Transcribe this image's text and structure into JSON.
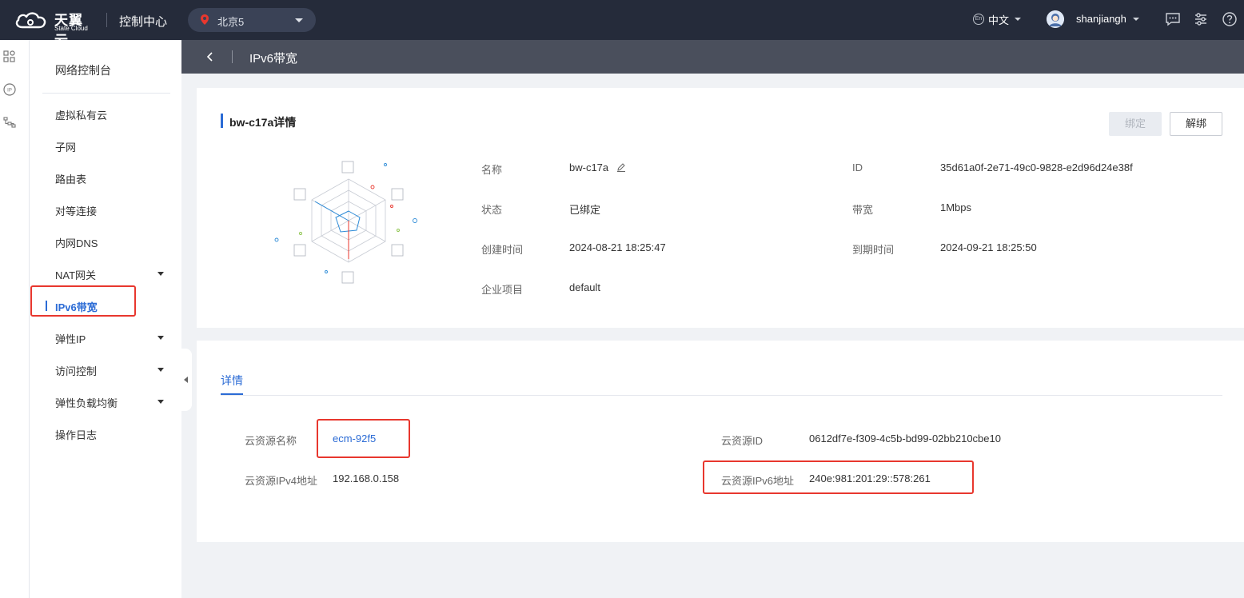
{
  "topbar": {
    "brand_cn": "天翼云",
    "brand_en": "State Cloud",
    "console": "控制中心",
    "region": "北京5",
    "lang": "中文",
    "lang_badge": "En",
    "username": "shanjiangh",
    "accent": "#252b3a"
  },
  "sidebar": {
    "title": "网络控制台",
    "items": [
      {
        "label": "虚拟私有云"
      },
      {
        "label": "子网"
      },
      {
        "label": "路由表"
      },
      {
        "label": "对等连接"
      },
      {
        "label": "内网DNS"
      },
      {
        "label": "NAT网关"
      },
      {
        "label": "IPv6带宽"
      },
      {
        "label": "弹性IP"
      },
      {
        "label": "访问控制"
      },
      {
        "label": "弹性负载均衡"
      },
      {
        "label": "操作日志"
      }
    ],
    "active": "IPv6带宽"
  },
  "header": {
    "title": "IPv6带宽"
  },
  "detail": {
    "heading": "bw-c17a详情",
    "bind_label": "绑定",
    "unbind_label": "解绑",
    "name_label": "名称",
    "name_value": "bw-c17a",
    "id_label": "ID",
    "id_value": "35d61a0f-2e71-49c0-9828-e2d96d24e38f",
    "status_label": "状态",
    "status_value": "已绑定",
    "bandwidth_label": "带宽",
    "bandwidth_value": "1Mbps",
    "created_label": "创建时间",
    "created_value": "2024-08-21 18:25:47",
    "expire_label": "到期时间",
    "expire_value": "2024-09-21 18:25:50",
    "project_label": "企业项目",
    "project_value": "default"
  },
  "resource": {
    "tab": "详情",
    "res_name_label": "云资源名称",
    "res_name_value": "ecm-92f5",
    "res_id_label": "云资源ID",
    "res_id_value": "0612df7e-f309-4c5b-bd99-02bb210cbe10",
    "ipv4_label": "云资源IPv4地址",
    "ipv4_value": "192.168.0.158",
    "ipv6_label": "云资源IPv6地址",
    "ipv6_value": "240e:981:201:29::578:261"
  },
  "colors": {
    "primary": "#2b6bd5",
    "highlight": "#e8372e"
  }
}
